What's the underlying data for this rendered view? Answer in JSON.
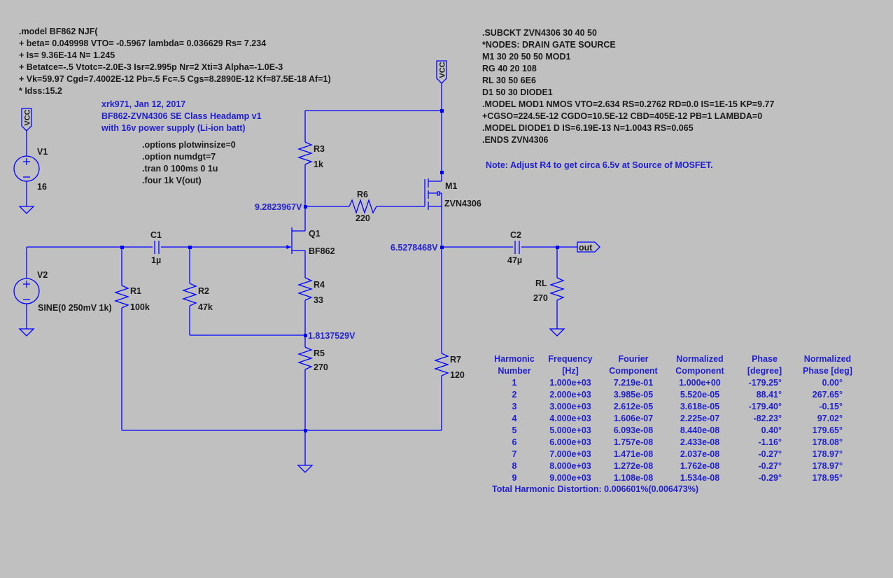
{
  "colors": {
    "wire": "#0000ff",
    "background": "#c0c0c0",
    "annotation": "#1f1fcf",
    "text": "#1a1a1a"
  },
  "directives": {
    "bf862_model": [
      ".model BF862 NJF(",
      "+ beta= 0.049998 VTO= -0.5967 lambda= 0.036629 Rs= 7.234",
      "+ Is= 9.36E-14 N= 1.245",
      "+ Betatce=-.5 Vtotc=-2.0E-3 Isr=2.995p Nr=2 Xti=3 Alpha=-1.0E-3",
      "+ Vk=59.97 Cgd=7.4002E-12 Pb=.5 Fc=.5 Cgs=8.2890E-12 Kf=87.5E-18 Af=1)",
      "* Idss:15.2"
    ],
    "zvn4306_subckt": [
      ".SUBCKT ZVN4306 30 40 50",
      "*NODES: DRAIN GATE SOURCE",
      "M1 30 20 50 50 MOD1",
      "RG 40 20 108",
      "RL 30 50 6E6",
      "D1 50 30 DIODE1",
      ".MODEL MOD1 NMOS VTO=2.634 RS=0.2762 RD=0.0 IS=1E-15 KP=9.77",
      "+CGSO=224.5E-12 CGDO=10.5E-12 CBD=405E-12 PB=1 LAMBDA=0",
      ".MODEL DIODE1 D IS=6.19E-13 N=1.0043 RS=0.065",
      ".ENDS ZVN4306"
    ],
    "sim_options": [
      ".options plotwinsize=0",
      ".option numdgt=7",
      ".tran 0 100ms 0 1u",
      ".four 1k V(out)"
    ]
  },
  "comments": {
    "title_block": [
      "xrk971, Jan 12, 2017",
      "BF862-ZVN4306 SE Class Headamp v1",
      "with 16v power supply (Li-ion batt)"
    ],
    "note": "Note: Adjust R4 to get circa 6.5v at Source of MOSFET."
  },
  "components": {
    "V1": {
      "name": "V1",
      "value": "16"
    },
    "V2": {
      "name": "V2",
      "value": "SINE(0 250mV 1k)"
    },
    "C1": {
      "name": "C1",
      "value": "1µ"
    },
    "C2": {
      "name": "C2",
      "value": "47µ"
    },
    "R1": {
      "name": "R1",
      "value": "100k"
    },
    "R2": {
      "name": "R2",
      "value": "47k"
    },
    "R3": {
      "name": "R3",
      "value": "1k"
    },
    "R4": {
      "name": "R4",
      "value": "33"
    },
    "R5": {
      "name": "R5",
      "value": "270"
    },
    "R6": {
      "name": "R6",
      "value": "220"
    },
    "R7": {
      "name": "R7",
      "value": "120"
    },
    "RL": {
      "name": "RL",
      "value": "270"
    },
    "Q1": {
      "name": "Q1",
      "value": "BF862"
    },
    "M1": {
      "name": "M1",
      "value": "ZVN4306"
    }
  },
  "net_labels": {
    "vcc": "VCC",
    "out": "out"
  },
  "node_voltages": {
    "q1_drain": "9.2823967V",
    "m1_source": "6.5278468V",
    "q1_source_divider": "1.8137529V"
  },
  "fourier": {
    "headers_top": [
      "Harmonic",
      "Frequency",
      "Fourier",
      "Normalized",
      "Phase",
      "Normalized"
    ],
    "headers_bottom": [
      "Number",
      "[Hz]",
      "Component",
      "Component",
      "[degree]",
      "Phase [deg]"
    ],
    "rows": [
      [
        "1",
        "1.000e+03",
        "7.219e-01",
        "1.000e+00",
        "-179.25°",
        "0.00°"
      ],
      [
        "2",
        "2.000e+03",
        "3.985e-05",
        "5.520e-05",
        "88.41°",
        "267.65°"
      ],
      [
        "3",
        "3.000e+03",
        "2.612e-05",
        "3.618e-05",
        "-179.40°",
        "-0.15°"
      ],
      [
        "4",
        "4.000e+03",
        "1.606e-07",
        "2.225e-07",
        "-82.23°",
        "97.02°"
      ],
      [
        "5",
        "5.000e+03",
        "6.093e-08",
        "8.440e-08",
        "0.40°",
        "179.65°"
      ],
      [
        "6",
        "6.000e+03",
        "1.757e-08",
        "2.433e-08",
        "-1.16°",
        "178.08°"
      ],
      [
        "7",
        "7.000e+03",
        "1.471e-08",
        "2.037e-08",
        "-0.27°",
        "178.97°"
      ],
      [
        "8",
        "8.000e+03",
        "1.272e-08",
        "1.762e-08",
        "-0.27°",
        "178.97°"
      ],
      [
        "9",
        "9.000e+03",
        "1.108e-08",
        "1.534e-08",
        "-0.29°",
        "178.95°"
      ]
    ],
    "thd": "Total Harmonic Distortion: 0.006601%(0.006473%)"
  }
}
